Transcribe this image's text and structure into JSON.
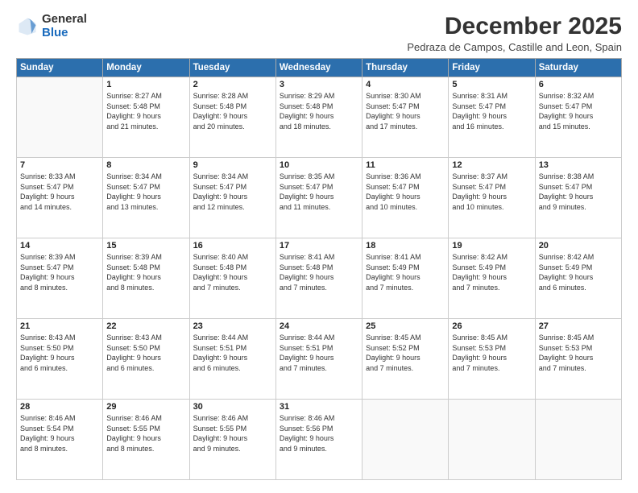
{
  "logo": {
    "general": "General",
    "blue": "Blue"
  },
  "title": "December 2025",
  "location": "Pedraza de Campos, Castille and Leon, Spain",
  "weekdays": [
    "Sunday",
    "Monday",
    "Tuesday",
    "Wednesday",
    "Thursday",
    "Friday",
    "Saturday"
  ],
  "weeks": [
    [
      {
        "day": "",
        "info": ""
      },
      {
        "day": "1",
        "info": "Sunrise: 8:27 AM\nSunset: 5:48 PM\nDaylight: 9 hours\nand 21 minutes."
      },
      {
        "day": "2",
        "info": "Sunrise: 8:28 AM\nSunset: 5:48 PM\nDaylight: 9 hours\nand 20 minutes."
      },
      {
        "day": "3",
        "info": "Sunrise: 8:29 AM\nSunset: 5:48 PM\nDaylight: 9 hours\nand 18 minutes."
      },
      {
        "day": "4",
        "info": "Sunrise: 8:30 AM\nSunset: 5:47 PM\nDaylight: 9 hours\nand 17 minutes."
      },
      {
        "day": "5",
        "info": "Sunrise: 8:31 AM\nSunset: 5:47 PM\nDaylight: 9 hours\nand 16 minutes."
      },
      {
        "day": "6",
        "info": "Sunrise: 8:32 AM\nSunset: 5:47 PM\nDaylight: 9 hours\nand 15 minutes."
      }
    ],
    [
      {
        "day": "7",
        "info": "Sunrise: 8:33 AM\nSunset: 5:47 PM\nDaylight: 9 hours\nand 14 minutes."
      },
      {
        "day": "8",
        "info": "Sunrise: 8:34 AM\nSunset: 5:47 PM\nDaylight: 9 hours\nand 13 minutes."
      },
      {
        "day": "9",
        "info": "Sunrise: 8:34 AM\nSunset: 5:47 PM\nDaylight: 9 hours\nand 12 minutes."
      },
      {
        "day": "10",
        "info": "Sunrise: 8:35 AM\nSunset: 5:47 PM\nDaylight: 9 hours\nand 11 minutes."
      },
      {
        "day": "11",
        "info": "Sunrise: 8:36 AM\nSunset: 5:47 PM\nDaylight: 9 hours\nand 10 minutes."
      },
      {
        "day": "12",
        "info": "Sunrise: 8:37 AM\nSunset: 5:47 PM\nDaylight: 9 hours\nand 10 minutes."
      },
      {
        "day": "13",
        "info": "Sunrise: 8:38 AM\nSunset: 5:47 PM\nDaylight: 9 hours\nand 9 minutes."
      }
    ],
    [
      {
        "day": "14",
        "info": "Sunrise: 8:39 AM\nSunset: 5:47 PM\nDaylight: 9 hours\nand 8 minutes."
      },
      {
        "day": "15",
        "info": "Sunrise: 8:39 AM\nSunset: 5:48 PM\nDaylight: 9 hours\nand 8 minutes."
      },
      {
        "day": "16",
        "info": "Sunrise: 8:40 AM\nSunset: 5:48 PM\nDaylight: 9 hours\nand 7 minutes."
      },
      {
        "day": "17",
        "info": "Sunrise: 8:41 AM\nSunset: 5:48 PM\nDaylight: 9 hours\nand 7 minutes."
      },
      {
        "day": "18",
        "info": "Sunrise: 8:41 AM\nSunset: 5:49 PM\nDaylight: 9 hours\nand 7 minutes."
      },
      {
        "day": "19",
        "info": "Sunrise: 8:42 AM\nSunset: 5:49 PM\nDaylight: 9 hours\nand 7 minutes."
      },
      {
        "day": "20",
        "info": "Sunrise: 8:42 AM\nSunset: 5:49 PM\nDaylight: 9 hours\nand 6 minutes."
      }
    ],
    [
      {
        "day": "21",
        "info": "Sunrise: 8:43 AM\nSunset: 5:50 PM\nDaylight: 9 hours\nand 6 minutes."
      },
      {
        "day": "22",
        "info": "Sunrise: 8:43 AM\nSunset: 5:50 PM\nDaylight: 9 hours\nand 6 minutes."
      },
      {
        "day": "23",
        "info": "Sunrise: 8:44 AM\nSunset: 5:51 PM\nDaylight: 9 hours\nand 6 minutes."
      },
      {
        "day": "24",
        "info": "Sunrise: 8:44 AM\nSunset: 5:51 PM\nDaylight: 9 hours\nand 7 minutes."
      },
      {
        "day": "25",
        "info": "Sunrise: 8:45 AM\nSunset: 5:52 PM\nDaylight: 9 hours\nand 7 minutes."
      },
      {
        "day": "26",
        "info": "Sunrise: 8:45 AM\nSunset: 5:53 PM\nDaylight: 9 hours\nand 7 minutes."
      },
      {
        "day": "27",
        "info": "Sunrise: 8:45 AM\nSunset: 5:53 PM\nDaylight: 9 hours\nand 7 minutes."
      }
    ],
    [
      {
        "day": "28",
        "info": "Sunrise: 8:46 AM\nSunset: 5:54 PM\nDaylight: 9 hours\nand 8 minutes."
      },
      {
        "day": "29",
        "info": "Sunrise: 8:46 AM\nSunset: 5:55 PM\nDaylight: 9 hours\nand 8 minutes."
      },
      {
        "day": "30",
        "info": "Sunrise: 8:46 AM\nSunset: 5:55 PM\nDaylight: 9 hours\nand 9 minutes."
      },
      {
        "day": "31",
        "info": "Sunrise: 8:46 AM\nSunset: 5:56 PM\nDaylight: 9 hours\nand 9 minutes."
      },
      {
        "day": "",
        "info": ""
      },
      {
        "day": "",
        "info": ""
      },
      {
        "day": "",
        "info": ""
      }
    ]
  ]
}
